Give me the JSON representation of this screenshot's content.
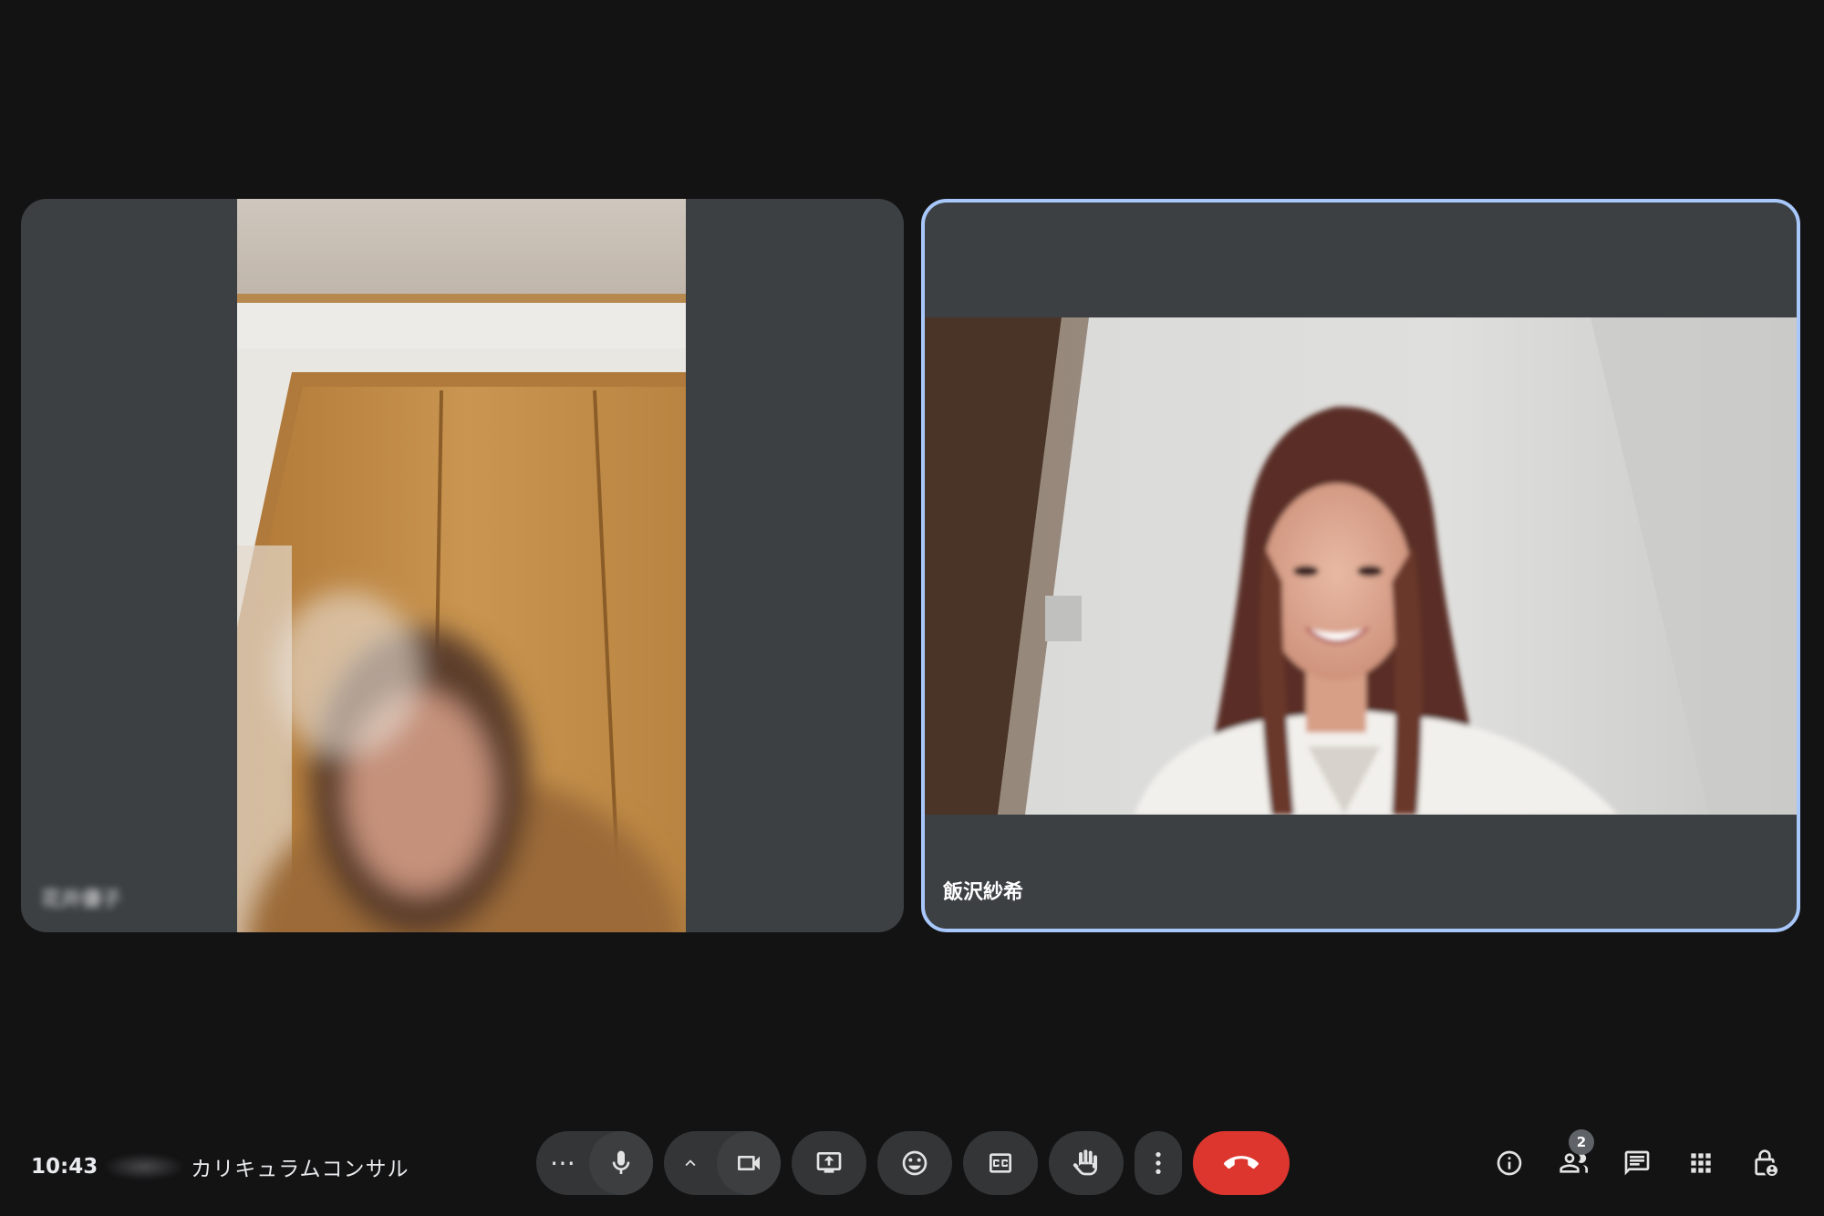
{
  "participants": [
    {
      "name": "花井優子",
      "blurred": true,
      "speaking": false
    },
    {
      "name": "飯沢紗希",
      "blurred": false,
      "speaking": true
    }
  ],
  "meeting": {
    "time": "10:43",
    "title": "カリキュラムコンサル"
  },
  "controls": {
    "more_options_glyph": "⋯",
    "mic_icon": "mic-icon",
    "camera_icon": "videocam-icon",
    "present_icon": "present-screen-icon",
    "reaction_icon": "emoji-icon",
    "captions_icon": "closed-captions-icon",
    "hand_icon": "raise-hand-icon",
    "overflow_icon": "more-vert-icon",
    "end_call_icon": "call-end-icon"
  },
  "side_panel": {
    "people_count": "2"
  },
  "colors": {
    "background": "#131314",
    "tile": "#3c4043",
    "active_border": "#a8c7fa",
    "end_call": "#dc362e"
  }
}
